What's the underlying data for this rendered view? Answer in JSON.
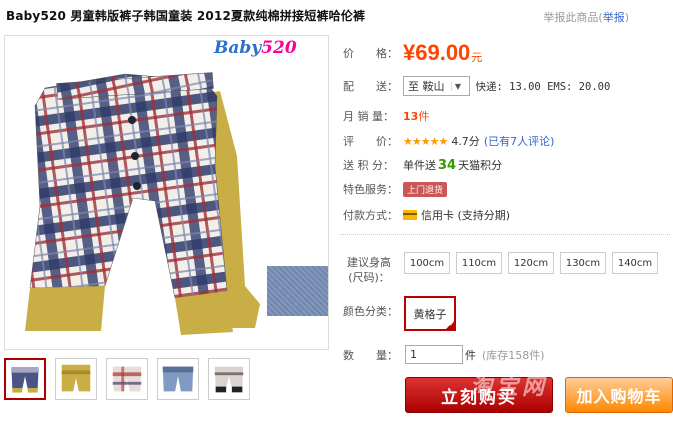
{
  "product": {
    "title": "Baby520 男童韩版裤子韩国童装 2012夏款纯棉拼接短裤哈伦裤"
  },
  "report": {
    "text": "举报此商品(",
    "link": "举报",
    "close": ")"
  },
  "brand_logo": {
    "text": "Baby",
    "num": "520"
  },
  "price": {
    "label": "价　　格：",
    "value": "¥69.00",
    "unit": "元"
  },
  "delivery": {
    "label": "配　　送：",
    "selected": "至 鞍山",
    "shipping": "快递: 13.00 EMS: 20.00"
  },
  "sales": {
    "label": "月 销 量：",
    "value": "13",
    "unit": "件"
  },
  "rating": {
    "label": "评　　价：",
    "stars": "★★★★★",
    "score": "4.7分",
    "reviews": "(已有7人评论)"
  },
  "points": {
    "label": "送 积 分：",
    "prefix": "单件送",
    "value": "34",
    "suffix": "天猫积分"
  },
  "service": {
    "label": "特色服务：",
    "badge": "上门退货"
  },
  "payment": {
    "label": "付款方式：",
    "method": "信用卡 (支持分期)"
  },
  "size": {
    "label_line1": "建议身高",
    "label_line2": "(尺码)：",
    "options": [
      "100cm",
      "110cm",
      "120cm",
      "130cm",
      "140cm"
    ]
  },
  "color": {
    "label": "颜色分类：",
    "selected": "黄格子"
  },
  "quantity": {
    "label": "数　　量：",
    "value": "1",
    "unit": "件",
    "stock": "(库存158件)"
  },
  "buttons": {
    "buy": "立刻购买",
    "cart": "加入购物车"
  },
  "watermark": "淘宝网"
}
